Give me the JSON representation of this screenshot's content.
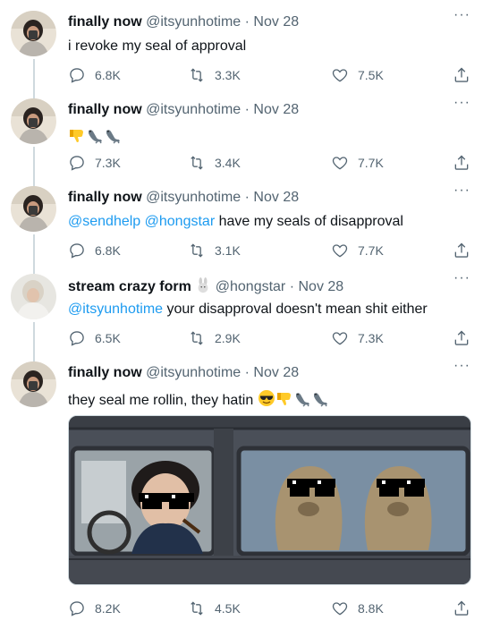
{
  "tweets": [
    {
      "name": "finally now",
      "handle": "@itsyunhotime",
      "dot": "·",
      "date": "Nov 28",
      "text_plain": "i revoke my seal of approval",
      "replies": "6.8K",
      "retweets": "3.3K",
      "likes": "7.5K",
      "more": "···"
    },
    {
      "name": "finally now",
      "handle": "@itsyunhotime",
      "dot": "·",
      "date": "Nov 28",
      "emojis": [
        "thumbs-down-emoji",
        "seal-emoji",
        "seal-emoji"
      ],
      "replies": "7.3K",
      "retweets": "3.4K",
      "likes": "7.7K",
      "more": "···"
    },
    {
      "name": "finally now",
      "handle": "@itsyunhotime",
      "dot": "·",
      "date": "Nov 28",
      "mention_1": "@sendhelp",
      "mention_2": "@hongstar",
      "text_rest": " have my seals of disapproval",
      "replies": "6.8K",
      "retweets": "3.1K",
      "likes": "7.7K",
      "more": "···"
    },
    {
      "name": "stream crazy form",
      "name_emoji": "rabbit-emoji",
      "handle": "@hongstar",
      "dot": "·",
      "date": "Nov 28",
      "mention_1": "@itsyunhotime",
      "text_rest": " your disapproval doesn't mean shit either",
      "replies": "6.5K",
      "retweets": "2.9K",
      "likes": "7.3K",
      "more": "···"
    },
    {
      "name": "finally now",
      "handle": "@itsyunhotime",
      "dot": "·",
      "date": "Nov 28",
      "text_plain": "they seal me rollin, they hatin ",
      "emojis": [
        "sunglasses-emoji",
        "thumbs-down-emoji",
        "seal-emoji",
        "seal-emoji"
      ],
      "media": "photo of a person and two seals in car windows wearing pixel sunglasses",
      "replies": "8.2K",
      "retweets": "4.5K",
      "likes": "8.8K",
      "more": "···"
    }
  ],
  "colors": {
    "text": "#0f1419",
    "secondary": "#536471",
    "link": "#1d9bf0",
    "thread": "#cfd9de"
  }
}
